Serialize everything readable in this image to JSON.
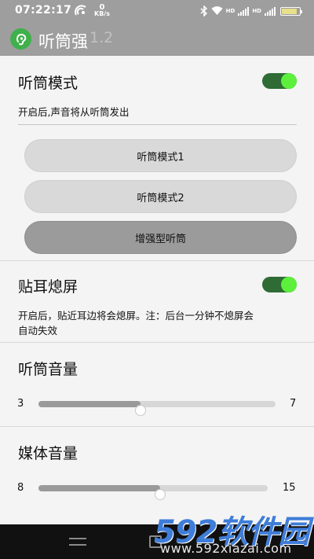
{
  "status_bar": {
    "time": "07:22:17",
    "speed_value": "0",
    "speed_unit": "KB/s",
    "net1": "HD",
    "net2": "HD",
    "battery_icon": "battery-icon"
  },
  "app": {
    "title": "听筒强",
    "version": "1.2",
    "icon": "ear-icon",
    "accent_color": "#3fb04b"
  },
  "earpiece_mode": {
    "title": "听筒模式",
    "enabled": true,
    "description": "开启后,声音将从听筒发出",
    "options": [
      {
        "label": "听筒模式1",
        "selected": false
      },
      {
        "label": "听筒模式2",
        "selected": false
      },
      {
        "label": "增强型听筒",
        "selected": true
      }
    ]
  },
  "proximity_screen_off": {
    "title": "贴耳熄屏",
    "enabled": true,
    "description_line1": "开启后，贴近耳边将会熄屏。注：后台一分钟不熄屏会",
    "description_line2": "自动失效"
  },
  "earpiece_volume": {
    "title": "听筒音量",
    "min": "3",
    "max": "7",
    "level_fraction": 0.43
  },
  "media_volume": {
    "title": "媒体音量",
    "min": "8",
    "max": "15",
    "level_fraction": 0.53
  },
  "watermark": {
    "brand": "592软件园",
    "url": "www.592xiazai.com"
  }
}
